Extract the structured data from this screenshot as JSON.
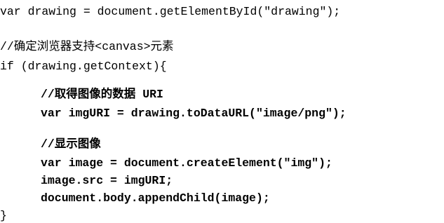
{
  "code": {
    "lines": [
      "var drawing = document.getElementById(\"drawing\");",
      "//确定浏览器支持<canvas>元素",
      "if (drawing.getContext){",
      "//取得图像的数据 URI",
      "var imgURI = drawing.toDataURL(\"image/png\");",
      "//显示图像",
      "var image = document.createElement(\"img\");",
      "image.src = imgURI;",
      "document.body.appendChild(image);",
      "}"
    ]
  }
}
